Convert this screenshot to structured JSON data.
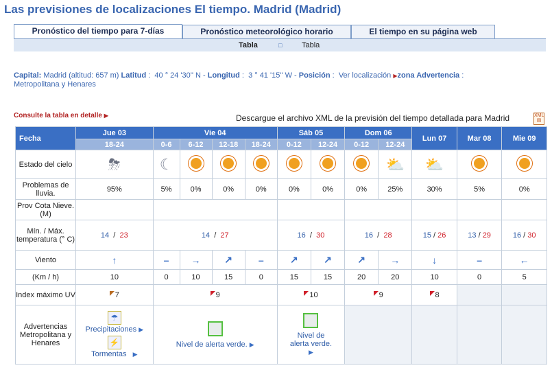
{
  "title": "Las previsiones de localizaciones El tiempo. Madrid (Madrid)",
  "tabs": [
    "Pronóstico del tiempo para 7-días",
    "Pronóstico meteorológico horario",
    "El tiempo en su página web"
  ],
  "subbar": {
    "left": "Tabla",
    "right": "Tabla"
  },
  "info": {
    "capital_label": "Capital:",
    "capital_value": "Madrid (altitud: 657 m)",
    "lat_label": "Latitud",
    "lat_value": "40 ° 24 '30'' N",
    "lon_label": "Longitud",
    "lon_value": "3 ° 41 '15'' W",
    "pos_label": "Posición",
    "pos_value": "Ver localización",
    "zone_label": "zona Advertencia",
    "zone_value": "Metropolitana y Henares"
  },
  "detail_link": "Consulte la tabla en detalle",
  "xml_text": "Descargue el archivo XML de la previsión del tiempo detallada para Madrid",
  "table": {
    "fecha": "Fecha",
    "days": [
      "Jue 03",
      "Vie 04",
      "Sáb 05",
      "Dom 06",
      "Lun 07",
      "Mar 08",
      "Mie 09"
    ],
    "periods": [
      "18-24",
      "0-6",
      "6-12",
      "12-18",
      "18-24",
      "0-12",
      "12-24",
      "0-12",
      "12-24"
    ],
    "labels": {
      "sky": "Estado del cielo",
      "rain": "Problemas de lluvia.",
      "snow": "Prov Cota Nieve. (M)",
      "temp": "Mín. / Máx. temperatura (° C)",
      "wind": "Viento",
      "kmh": "(Km / h)",
      "uv": "Index máximo UV",
      "warn": "Advertencias Metropolitana y Henares"
    },
    "rain": [
      "95%",
      "5%",
      "0%",
      "0%",
      "0%",
      "0%",
      "0%",
      "0%",
      "25%",
      "30%",
      "5%",
      "0%"
    ],
    "temps": [
      {
        "min": "14",
        "max": "23"
      },
      {
        "min": "14",
        "max": "27"
      },
      {
        "min": "16",
        "max": "30"
      },
      {
        "min": "16",
        "max": "28"
      },
      {
        "min": "15",
        "max": "26"
      },
      {
        "min": "13",
        "max": "29"
      },
      {
        "min": "16",
        "max": "30"
      }
    ],
    "wind_speed": [
      "10",
      "0",
      "10",
      "15",
      "0",
      "15",
      "15",
      "20",
      "20",
      "10",
      "0",
      "5"
    ],
    "uv": [
      "7",
      "9",
      "10",
      "9",
      "8"
    ],
    "warn": {
      "precip": "Precipitaciones",
      "storms": "Tormentas",
      "green": "Nivel de alerta verde."
    },
    "slash": "/"
  }
}
